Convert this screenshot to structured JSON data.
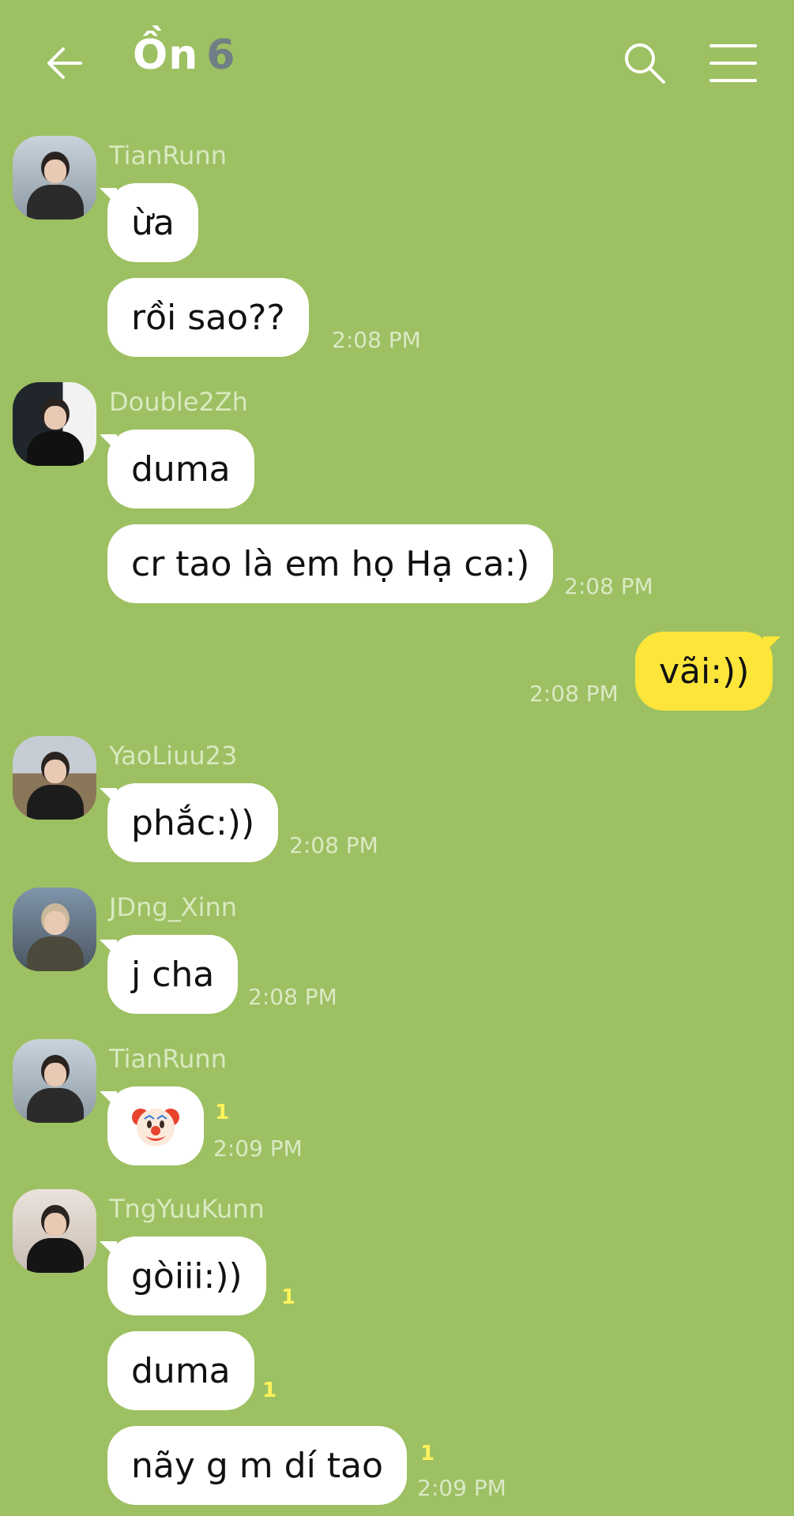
{
  "header": {
    "title": "Ồn",
    "member_count": "6"
  },
  "messages": [
    {
      "sender": "TianRunn",
      "texts": [
        "ừa",
        "rồi sao??"
      ],
      "time": "2:08 PM"
    },
    {
      "sender": "Double2Zh",
      "texts": [
        "duma",
        "cr tao là em họ Hạ ca:)"
      ],
      "time": "2:08 PM"
    },
    {
      "mine": true,
      "text": "vãi:))",
      "time": "2:08 PM"
    },
    {
      "sender": "YaoLiuu23",
      "text": "phắc:))",
      "time": "2:08 PM"
    },
    {
      "sender": "JDng_Xinn",
      "text": "j cha",
      "time": "2:08 PM"
    },
    {
      "sender": "TianRunn",
      "emoji": "clown-face",
      "unread": "1",
      "time": "2:09 PM"
    },
    {
      "sender": "TngYuuKunn",
      "texts": [
        "gòiii:))",
        "duma",
        "nãy g m dí tao"
      ],
      "unread": [
        "1",
        "1",
        "1"
      ],
      "time": "2:09 PM"
    }
  ],
  "colors": {
    "background": "#9dc062",
    "incoming_bubble": "#ffffff",
    "outgoing_bubble": "#fde53a",
    "unread": "#fff25c"
  }
}
